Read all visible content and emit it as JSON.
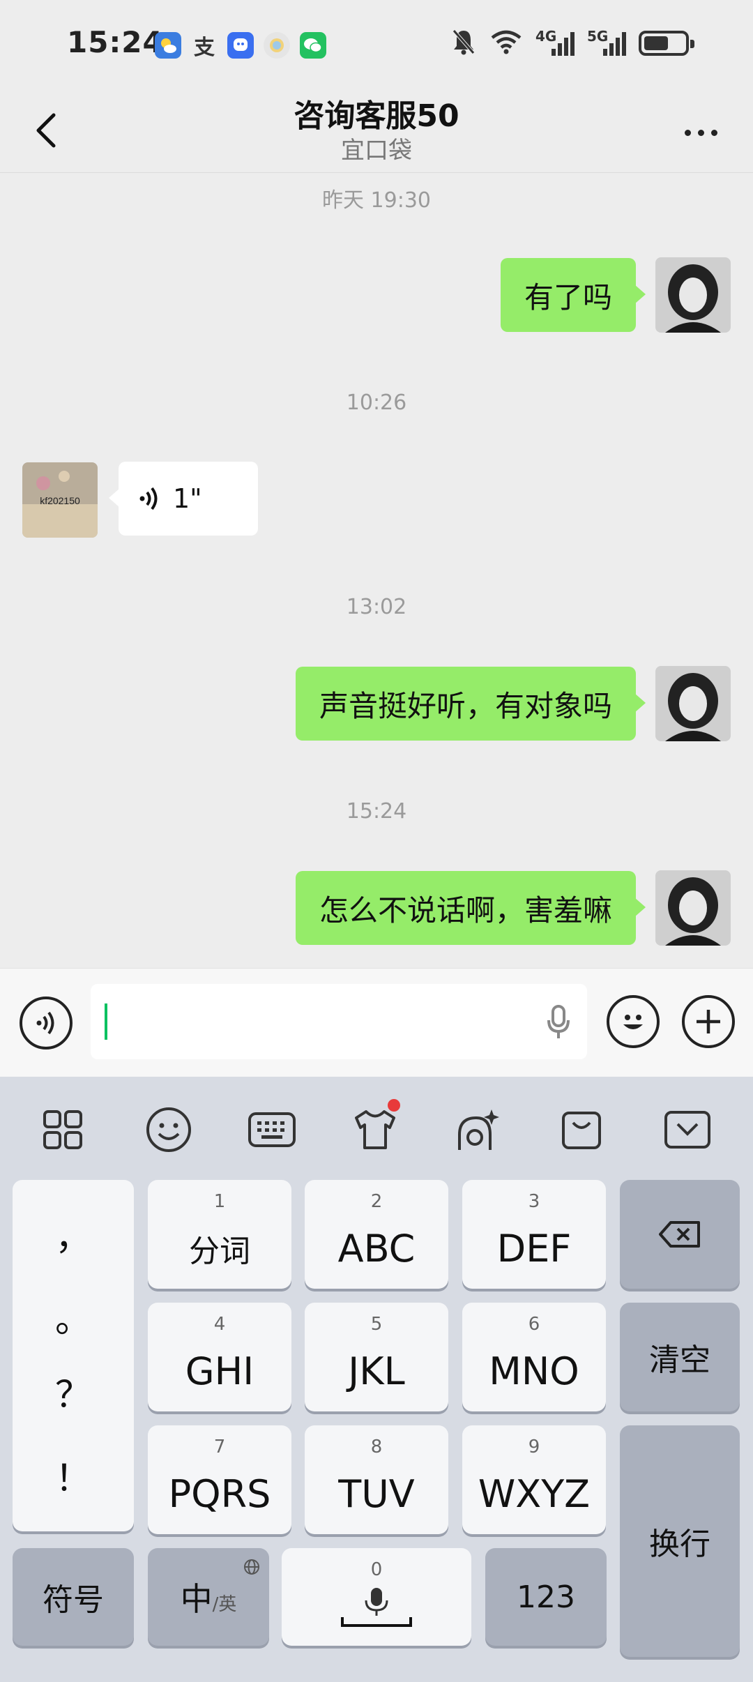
{
  "status_bar": {
    "time": "15:24",
    "network_1": "4G",
    "network_2": "5G",
    "battery_level": 0.6,
    "app_icons": [
      "weather-app-icon",
      "alipay-icon",
      "qq-icon",
      "app-icon",
      "wechat-icon"
    ],
    "status_icons": [
      "mute-bell-icon",
      "wifi-icon",
      "signal-icon",
      "battery-icon"
    ]
  },
  "header": {
    "title": "咨询客服50",
    "subtitle": "宜口袋"
  },
  "messages": [
    {
      "type": "timestamp",
      "text": "昨天 19:30"
    },
    {
      "type": "outgoing",
      "text": "有了吗"
    },
    {
      "type": "timestamp",
      "text": "10:26"
    },
    {
      "type": "incoming_voice",
      "duration": "1\"",
      "avatar_text": "kf202150"
    },
    {
      "type": "timestamp",
      "text": "13:02"
    },
    {
      "type": "outgoing",
      "text": "声音挺好听，有对象吗"
    },
    {
      "type": "timestamp",
      "text": "15:24"
    },
    {
      "type": "outgoing",
      "text": "怎么不说话啊，害羞嘛"
    }
  ],
  "input_bar": {
    "value": "",
    "icons": [
      "voice-toggle-icon",
      "microphone-icon",
      "emoji-icon",
      "plus-icon"
    ]
  },
  "keyboard": {
    "toolbar": [
      "apps-grid-icon",
      "emoji-icon",
      "keyboard-icon",
      "skin-shirt-icon",
      "ai-assistant-icon",
      "shopping-bag-icon",
      "collapse-keyboard-icon"
    ],
    "toolbar_badge_color": "#e83a3a",
    "punctuation": [
      "，",
      "。",
      "？",
      "！"
    ],
    "keys": [
      {
        "num": "1",
        "label": "分词"
      },
      {
        "num": "2",
        "label": "ABC"
      },
      {
        "num": "3",
        "label": "DEF"
      },
      {
        "num": "4",
        "label": "GHI"
      },
      {
        "num": "5",
        "label": "JKL"
      },
      {
        "num": "6",
        "label": "MNO"
      },
      {
        "num": "7",
        "label": "PQRS"
      },
      {
        "num": "8",
        "label": "TUV"
      },
      {
        "num": "9",
        "label": "WXYZ"
      }
    ],
    "clear": "清空",
    "enter": "换行",
    "symbols": "符号",
    "lang_main": "中",
    "lang_sub": "/英",
    "space_num": "0",
    "numbers": "123"
  },
  "colors": {
    "bubble_out": "#95ec69",
    "bubble_in": "#ffffff",
    "chat_bg": "#ededed",
    "caret": "#07c160",
    "keyboard_bg": "#d7dbe3"
  }
}
